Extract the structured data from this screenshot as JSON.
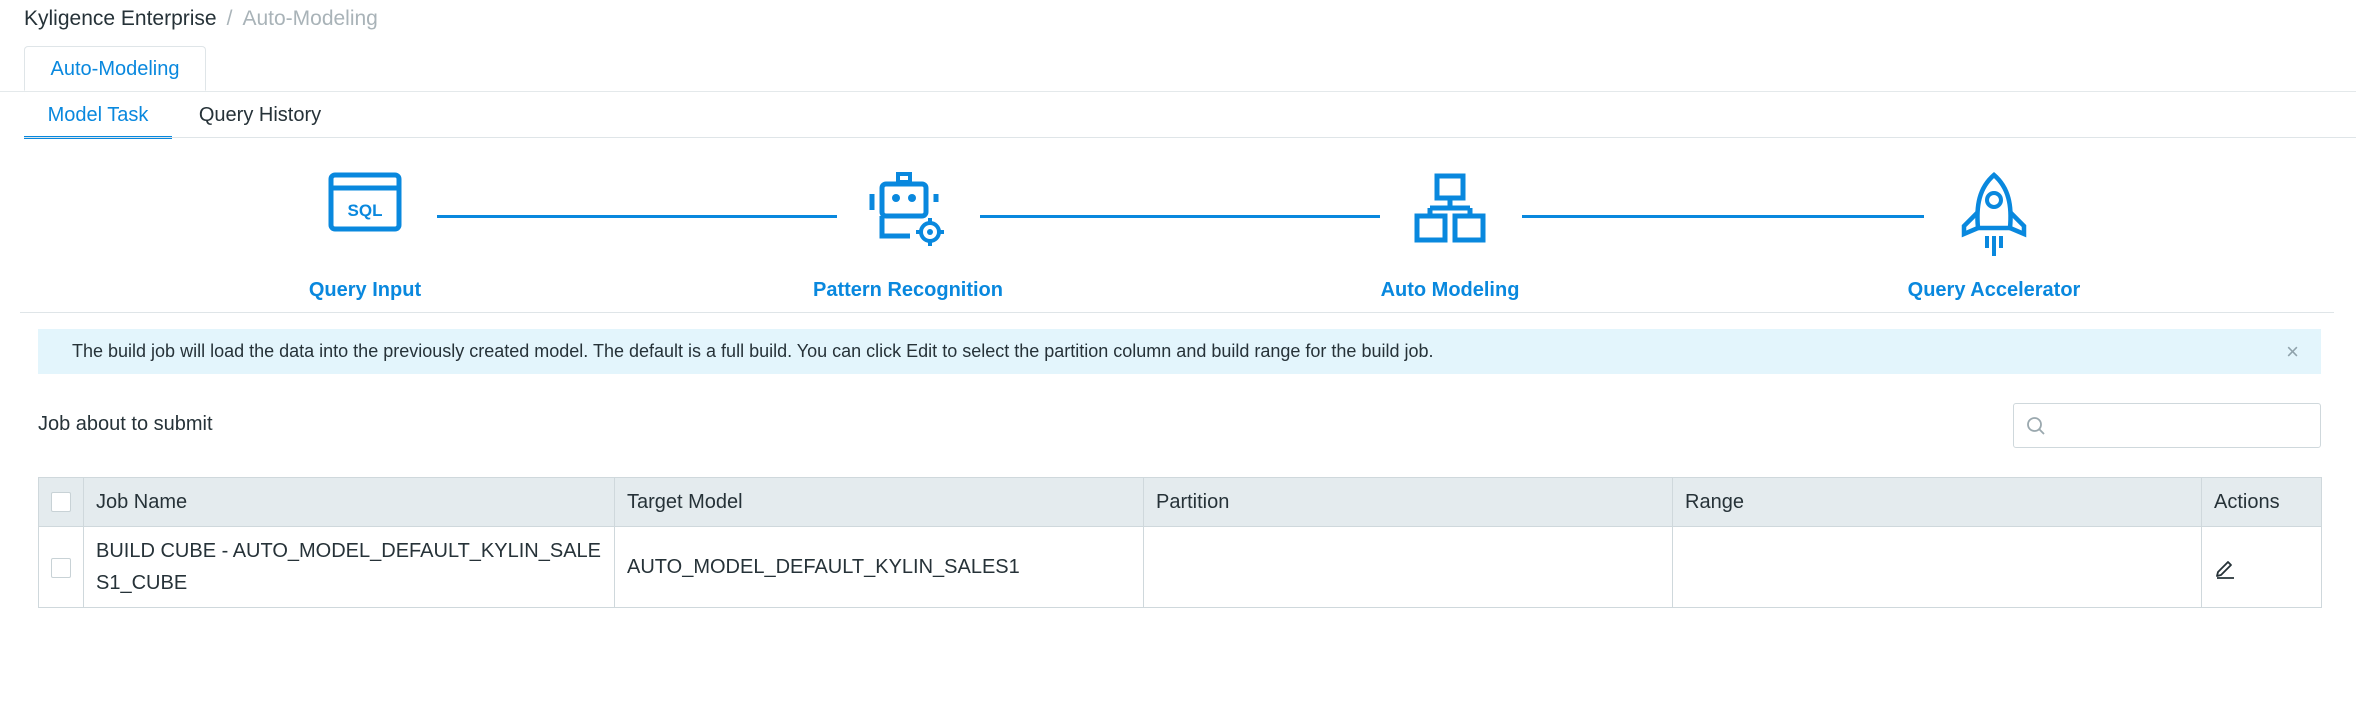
{
  "breadcrumb": {
    "root": "Kyligence Enterprise",
    "separator": "/",
    "current": "Auto-Modeling"
  },
  "top_tab": {
    "label": "Auto-Modeling"
  },
  "sub_tabs": [
    {
      "label": "Model Task",
      "active": true
    },
    {
      "label": "Query History",
      "active": false
    }
  ],
  "steps": [
    {
      "label": "Query Input",
      "icon": "sql-window-icon",
      "icon_text": "SQL"
    },
    {
      "label": "Pattern Recognition",
      "icon": "robot-gear-icon"
    },
    {
      "label": "Auto Modeling",
      "icon": "hierarchy-blocks-icon"
    },
    {
      "label": "Query Accelerator",
      "icon": "rocket-icon"
    }
  ],
  "alert": {
    "text": "The build job will load the data into the previously created model. The default is a full build. You can click Edit to select the partition column and build range for the build job.",
    "close_symbol": "×"
  },
  "section": {
    "title": "Job about to submit"
  },
  "search": {
    "placeholder": ""
  },
  "table": {
    "columns": [
      "Job Name",
      "Target Model",
      "Partition",
      "Range",
      "Actions"
    ],
    "rows": [
      {
        "job_name": "BUILD CUBE - AUTO_MODEL_DEFAULT_KYLIN_SALES1_CUBE",
        "target_model": "AUTO_MODEL_DEFAULT_KYLIN_SALES1",
        "partition": "",
        "range": "",
        "action_icon": "edit-pencil-icon"
      }
    ]
  },
  "colors": {
    "accent": "#0988de",
    "alert_bg": "#e3f5fc",
    "header_bg": "#e4ebee",
    "border": "#cfd8dc"
  }
}
